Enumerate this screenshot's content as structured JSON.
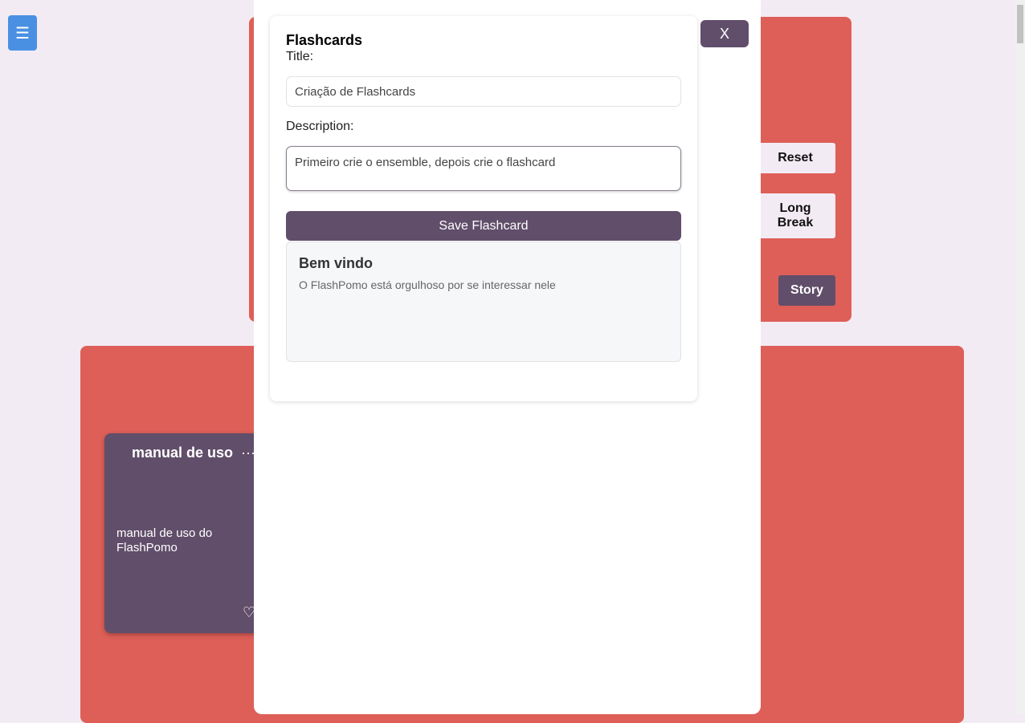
{
  "menu": {
    "icon": "☰"
  },
  "timer": {
    "reset": "Reset",
    "long_break": "Long Break",
    "story": "Story"
  },
  "card": {
    "title": "manual de uso",
    "more": "···",
    "body": "manual de uso do FlashPomo",
    "heart": "♡"
  },
  "modal": {
    "heading": "Flashcards",
    "title_label": "Title:",
    "title_value": "Criação de Flashcards",
    "desc_label": "Description:",
    "desc_value": "Primeiro crie o ensemble, depois crie o flashcard",
    "save": "Save Flashcard",
    "close": "X",
    "preview": {
      "title": "Bem vindo",
      "text": "O FlashPomo está orgulhoso por se interessar nele"
    }
  }
}
